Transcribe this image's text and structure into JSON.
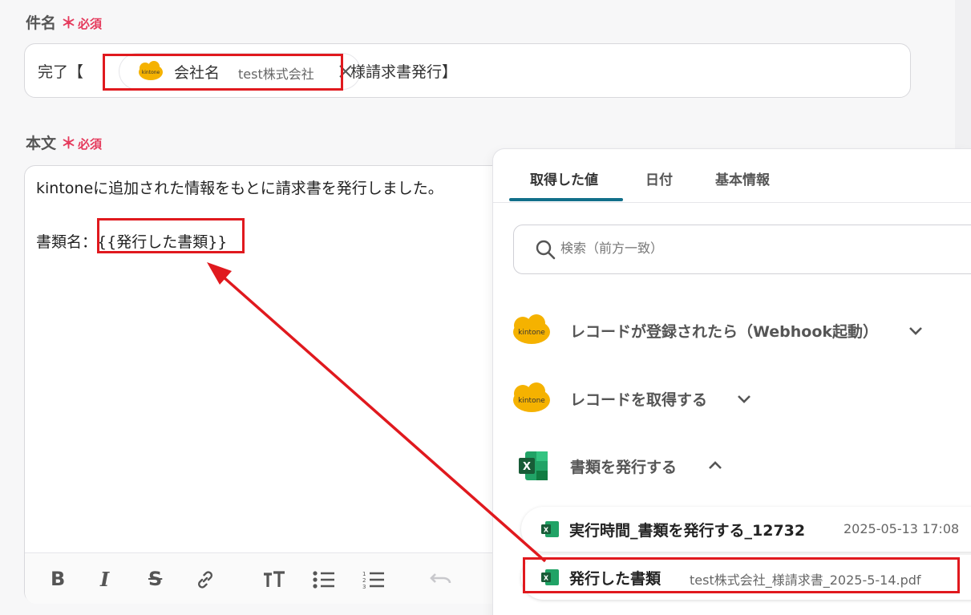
{
  "subject": {
    "label": "件名",
    "required_mark": "＊",
    "required_text": "必須",
    "prefix": "完了【",
    "chip": {
      "name": "会社名",
      "value": "test株式会社"
    },
    "suffix": "様請求書発行】"
  },
  "body": {
    "label": "本文",
    "required_mark": "＊",
    "required_text": "必須",
    "line1": "kintoneに追加された情報をもとに請求書を発行しました。",
    "line2_prefix": "書類名：",
    "line2_var": "{{発行した書類}}"
  },
  "toolbar": {
    "bold": "B",
    "italic": "I",
    "strike": "S",
    "link": "link-icon",
    "text_size": "text-size-icon",
    "bullet_list": "bullet-list-icon",
    "numbered_list": "numbered-list-icon",
    "undo": "undo-icon"
  },
  "panel": {
    "tabs": [
      "取得した値",
      "日付",
      "基本情報"
    ],
    "search_placeholder": "検索（前方一致）",
    "steps": [
      {
        "title": "レコードが登録されたら（Webhook起動）",
        "icon": "kintone-logo",
        "expanded": false
      },
      {
        "title": "レコードを取得する",
        "icon": "kintone-logo",
        "expanded": false
      },
      {
        "title": "書類を発行する",
        "icon": "excel-icon",
        "expanded": true
      }
    ],
    "outputs": [
      {
        "name": "実行時間_書類を発行する_12732",
        "value": "2025-05-13 17:08"
      },
      {
        "name": "発行した書類",
        "value": "test株式会社_様請求書_2025-5-14.pdf"
      }
    ],
    "kintone_logo_text": "kintone"
  },
  "colors": {
    "highlight": "#e0191e",
    "required": "#e53a5c",
    "tab_active": "#126f8a",
    "kintone": "#f5b200",
    "excel": "#1d7044"
  }
}
